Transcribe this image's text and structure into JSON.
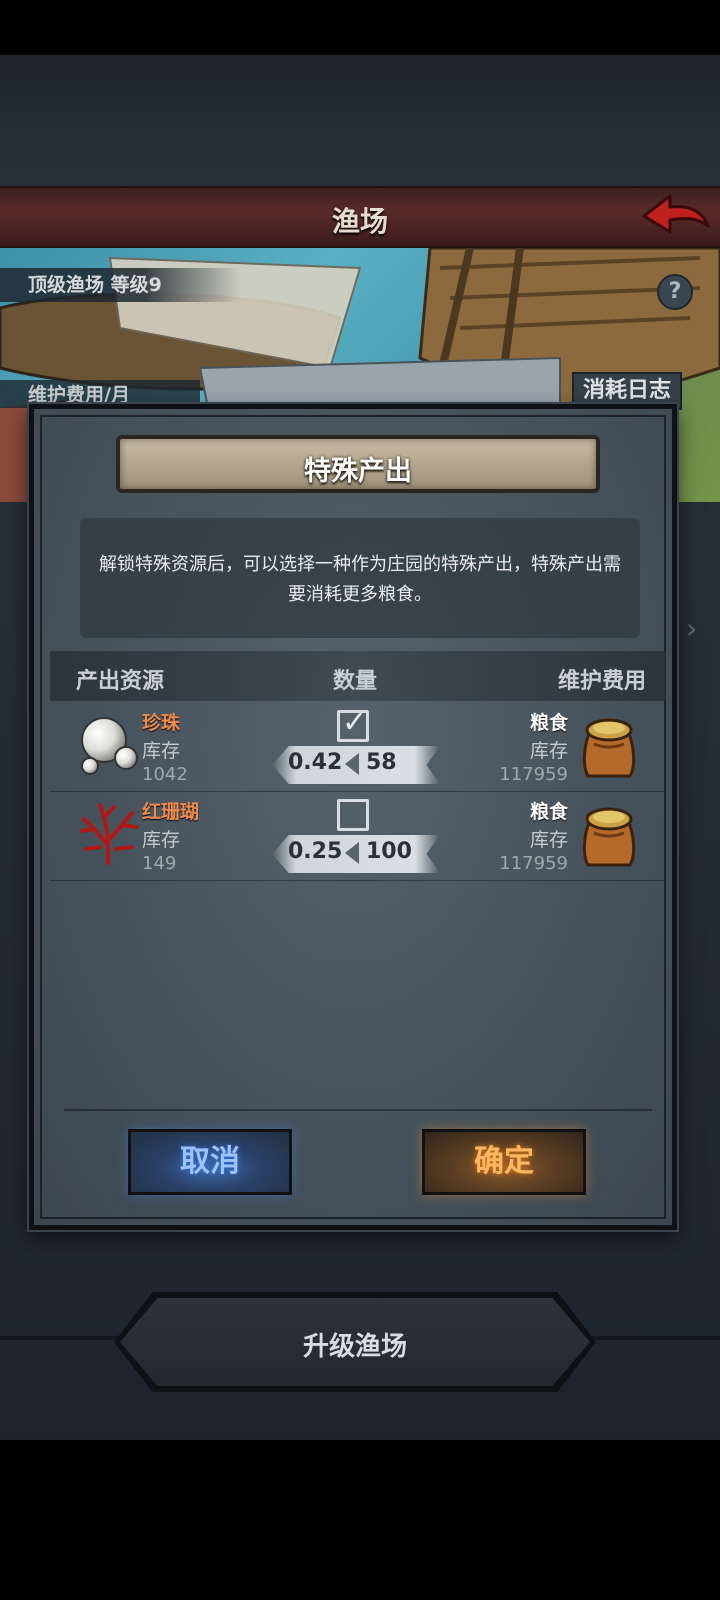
{
  "header": {
    "title": "渔场"
  },
  "scene": {
    "level_label": "顶级渔场 等级9",
    "upkeep_label": "维护费用/月",
    "help_glyph": "?",
    "log_button": "消耗日志"
  },
  "dialog": {
    "title": "特殊产出",
    "description": "解锁特殊资源后，可以选择一种作为庄园的特殊产出，特殊产出需要消耗更多粮食。",
    "columns": {
      "resource": "产出资源",
      "quantity": "数量",
      "cost": "维护费用"
    },
    "rows": [
      {
        "name": "珍珠",
        "icon": "pearl-icon",
        "stock_label": "库存",
        "stock": "1042",
        "checked": true,
        "ratio_a": "0.42",
        "ratio_b": "58",
        "cost_name": "粮食",
        "cost_stock_label": "库存",
        "cost_stock": "117959",
        "cost_icon": "grain-sack-icon"
      },
      {
        "name": "红珊瑚",
        "icon": "red-coral-icon",
        "stock_label": "库存",
        "stock": "149",
        "checked": false,
        "ratio_a": "0.25",
        "ratio_b": "100",
        "cost_name": "粮食",
        "cost_stock_label": "库存",
        "cost_stock": "117959",
        "cost_icon": "grain-sack-icon"
      }
    ],
    "cancel_label": "取消",
    "confirm_label": "确定"
  },
  "footer": {
    "upgrade_label": "升级渔场"
  },
  "colors": {
    "header_red": "#5a2a2a",
    "resource_name": "#f08a4a",
    "cancel_glow": "#3e6aa8",
    "confirm_glow": "#d77a1a"
  }
}
